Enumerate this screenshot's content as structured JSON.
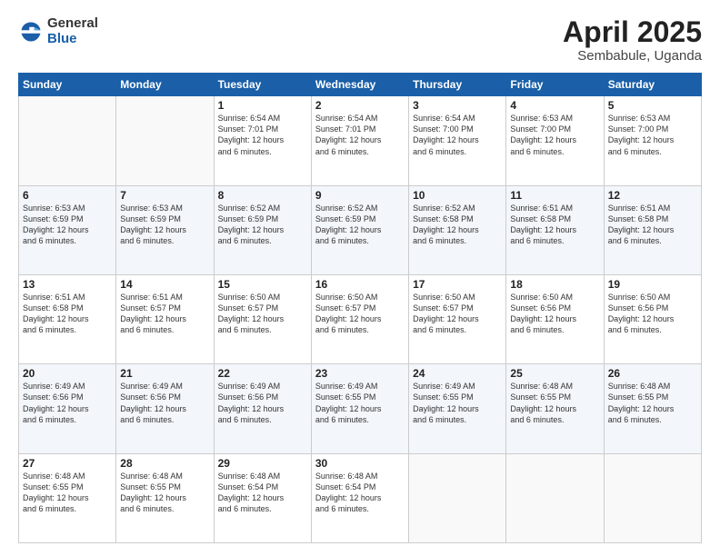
{
  "logo": {
    "general": "General",
    "blue": "Blue"
  },
  "title": "April 2025",
  "location": "Sembabule, Uganda",
  "days_of_week": [
    "Sunday",
    "Monday",
    "Tuesday",
    "Wednesday",
    "Thursday",
    "Friday",
    "Saturday"
  ],
  "weeks": [
    [
      {
        "day": "",
        "info": ""
      },
      {
        "day": "",
        "info": ""
      },
      {
        "day": "1",
        "info": "Sunrise: 6:54 AM\nSunset: 7:01 PM\nDaylight: 12 hours\nand 6 minutes."
      },
      {
        "day": "2",
        "info": "Sunrise: 6:54 AM\nSunset: 7:01 PM\nDaylight: 12 hours\nand 6 minutes."
      },
      {
        "day": "3",
        "info": "Sunrise: 6:54 AM\nSunset: 7:00 PM\nDaylight: 12 hours\nand 6 minutes."
      },
      {
        "day": "4",
        "info": "Sunrise: 6:53 AM\nSunset: 7:00 PM\nDaylight: 12 hours\nand 6 minutes."
      },
      {
        "day": "5",
        "info": "Sunrise: 6:53 AM\nSunset: 7:00 PM\nDaylight: 12 hours\nand 6 minutes."
      }
    ],
    [
      {
        "day": "6",
        "info": "Sunrise: 6:53 AM\nSunset: 6:59 PM\nDaylight: 12 hours\nand 6 minutes."
      },
      {
        "day": "7",
        "info": "Sunrise: 6:53 AM\nSunset: 6:59 PM\nDaylight: 12 hours\nand 6 minutes."
      },
      {
        "day": "8",
        "info": "Sunrise: 6:52 AM\nSunset: 6:59 PM\nDaylight: 12 hours\nand 6 minutes."
      },
      {
        "day": "9",
        "info": "Sunrise: 6:52 AM\nSunset: 6:59 PM\nDaylight: 12 hours\nand 6 minutes."
      },
      {
        "day": "10",
        "info": "Sunrise: 6:52 AM\nSunset: 6:58 PM\nDaylight: 12 hours\nand 6 minutes."
      },
      {
        "day": "11",
        "info": "Sunrise: 6:51 AM\nSunset: 6:58 PM\nDaylight: 12 hours\nand 6 minutes."
      },
      {
        "day": "12",
        "info": "Sunrise: 6:51 AM\nSunset: 6:58 PM\nDaylight: 12 hours\nand 6 minutes."
      }
    ],
    [
      {
        "day": "13",
        "info": "Sunrise: 6:51 AM\nSunset: 6:58 PM\nDaylight: 12 hours\nand 6 minutes."
      },
      {
        "day": "14",
        "info": "Sunrise: 6:51 AM\nSunset: 6:57 PM\nDaylight: 12 hours\nand 6 minutes."
      },
      {
        "day": "15",
        "info": "Sunrise: 6:50 AM\nSunset: 6:57 PM\nDaylight: 12 hours\nand 6 minutes."
      },
      {
        "day": "16",
        "info": "Sunrise: 6:50 AM\nSunset: 6:57 PM\nDaylight: 12 hours\nand 6 minutes."
      },
      {
        "day": "17",
        "info": "Sunrise: 6:50 AM\nSunset: 6:57 PM\nDaylight: 12 hours\nand 6 minutes."
      },
      {
        "day": "18",
        "info": "Sunrise: 6:50 AM\nSunset: 6:56 PM\nDaylight: 12 hours\nand 6 minutes."
      },
      {
        "day": "19",
        "info": "Sunrise: 6:50 AM\nSunset: 6:56 PM\nDaylight: 12 hours\nand 6 minutes."
      }
    ],
    [
      {
        "day": "20",
        "info": "Sunrise: 6:49 AM\nSunset: 6:56 PM\nDaylight: 12 hours\nand 6 minutes."
      },
      {
        "day": "21",
        "info": "Sunrise: 6:49 AM\nSunset: 6:56 PM\nDaylight: 12 hours\nand 6 minutes."
      },
      {
        "day": "22",
        "info": "Sunrise: 6:49 AM\nSunset: 6:56 PM\nDaylight: 12 hours\nand 6 minutes."
      },
      {
        "day": "23",
        "info": "Sunrise: 6:49 AM\nSunset: 6:55 PM\nDaylight: 12 hours\nand 6 minutes."
      },
      {
        "day": "24",
        "info": "Sunrise: 6:49 AM\nSunset: 6:55 PM\nDaylight: 12 hours\nand 6 minutes."
      },
      {
        "day": "25",
        "info": "Sunrise: 6:48 AM\nSunset: 6:55 PM\nDaylight: 12 hours\nand 6 minutes."
      },
      {
        "day": "26",
        "info": "Sunrise: 6:48 AM\nSunset: 6:55 PM\nDaylight: 12 hours\nand 6 minutes."
      }
    ],
    [
      {
        "day": "27",
        "info": "Sunrise: 6:48 AM\nSunset: 6:55 PM\nDaylight: 12 hours\nand 6 minutes."
      },
      {
        "day": "28",
        "info": "Sunrise: 6:48 AM\nSunset: 6:55 PM\nDaylight: 12 hours\nand 6 minutes."
      },
      {
        "day": "29",
        "info": "Sunrise: 6:48 AM\nSunset: 6:54 PM\nDaylight: 12 hours\nand 6 minutes."
      },
      {
        "day": "30",
        "info": "Sunrise: 6:48 AM\nSunset: 6:54 PM\nDaylight: 12 hours\nand 6 minutes."
      },
      {
        "day": "",
        "info": ""
      },
      {
        "day": "",
        "info": ""
      },
      {
        "day": "",
        "info": ""
      }
    ]
  ]
}
